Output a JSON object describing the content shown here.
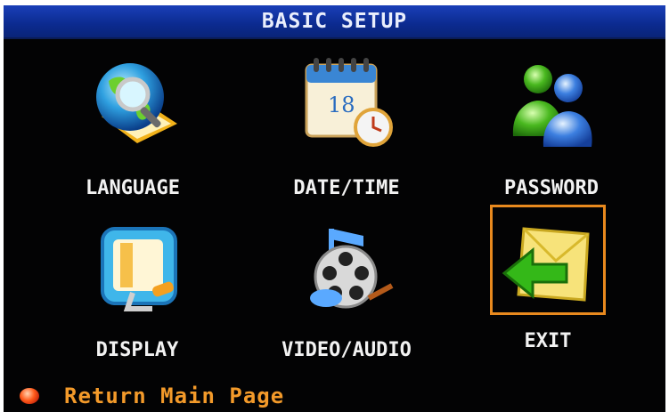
{
  "header": {
    "title": "BASIC SETUP"
  },
  "menu": {
    "items": [
      {
        "label": "LANGUAGE",
        "icon": "globe-magnifier-icon"
      },
      {
        "label": "DATE/TIME",
        "icon": "calendar-clock-icon"
      },
      {
        "label": "PASSWORD",
        "icon": "users-icon"
      },
      {
        "label": "DISPLAY",
        "icon": "monitor-icon"
      },
      {
        "label": "VIDEO/AUDIO",
        "icon": "film-reel-music-icon"
      },
      {
        "label": "EXIT",
        "icon": "exit-arrow-icon"
      }
    ],
    "selected": "EXIT",
    "calendar_day": "18"
  },
  "footer": {
    "hint": "Return Main Page",
    "hint_color": "#f39a2a"
  },
  "colors": {
    "title_bar": "#0b2a8f",
    "selection": "#e8891e",
    "background": "#030304"
  }
}
